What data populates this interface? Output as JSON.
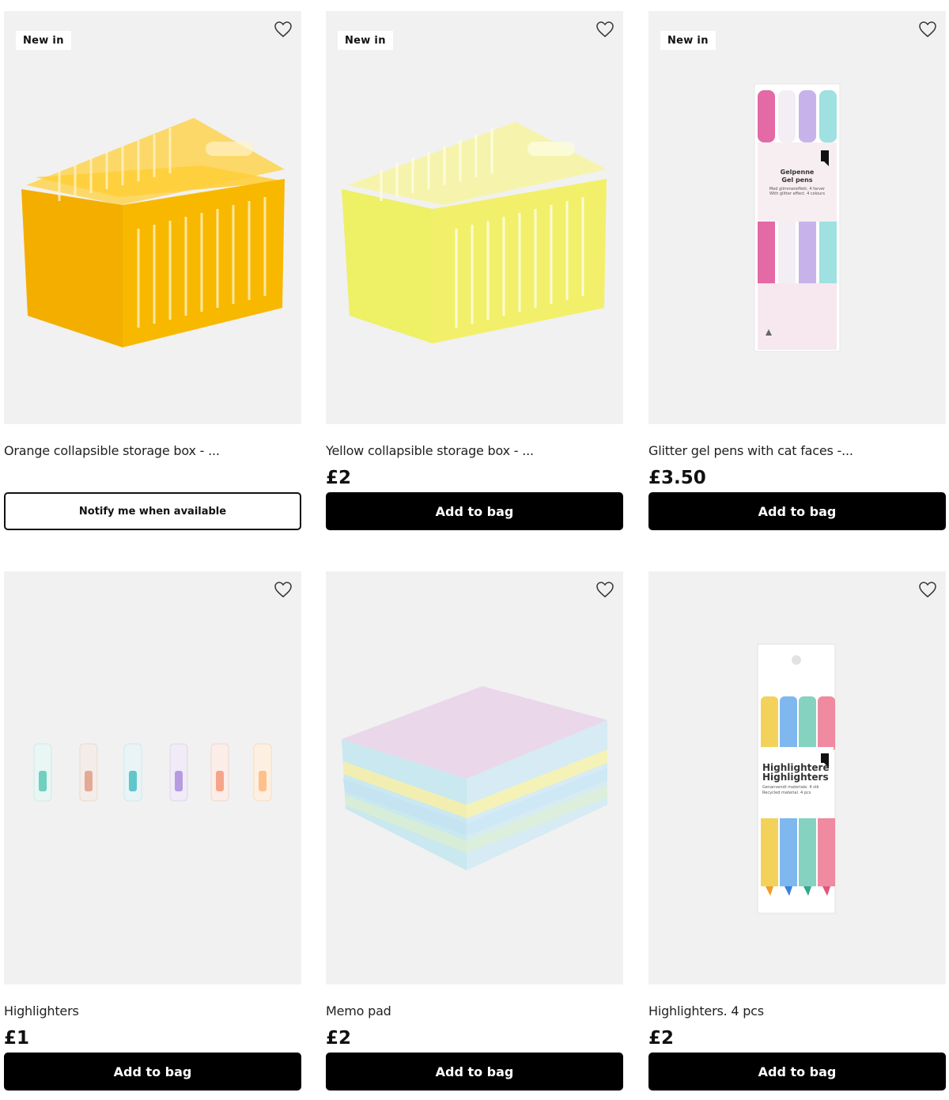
{
  "products": [
    {
      "badge": "New in",
      "title": "Orange collapsible storage box - ...",
      "price": "",
      "button": "Notify me when available"
    },
    {
      "badge": "New in",
      "title": "Yellow collapsible storage box - ...",
      "price": "£2",
      "button": "Add to bag"
    },
    {
      "badge": "New in",
      "title": "Glitter gel pens with cat faces -...",
      "price": "£3.50",
      "button": "Add to bag"
    },
    {
      "badge": "",
      "title": "Highlighters",
      "price": "£1",
      "button": "Add to bag"
    },
    {
      "badge": "",
      "title": "Memo pad",
      "price": "£2",
      "button": "Add to bag"
    },
    {
      "badge": "",
      "title": "Highlighters. 4 pcs",
      "price": "£2",
      "button": "Add to bag"
    }
  ],
  "pack_text": {
    "gel_pens": [
      "Gelpenne",
      "Gel pens",
      "Med glimmereffekt. 4 farver",
      "With glitter effect. 4 colours"
    ],
    "highlighters": [
      "Highlightere",
      "Highlighters",
      "Genanvendt materiale. 4 stk",
      "Recycled material. 4 pcs"
    ]
  },
  "colors": {
    "button_bg": "#000000",
    "card_bg": "#f1f1f1",
    "orange_crate": "#f6b400",
    "yellow_crate": "#f2f06a"
  },
  "icons": {
    "wishlist": "heart-outline-icon"
  }
}
